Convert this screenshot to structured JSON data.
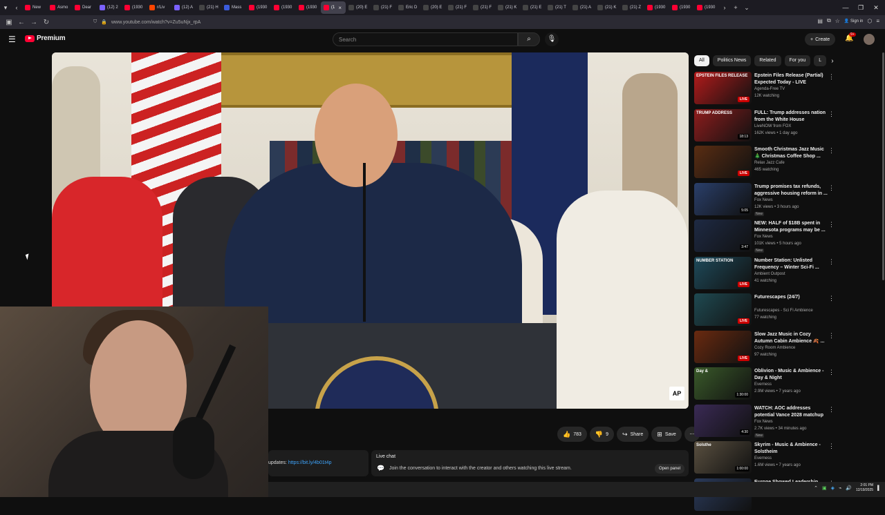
{
  "browser": {
    "tabs": [
      {
        "label": "New",
        "color": "#ff0033"
      },
      {
        "label": "Asmo",
        "color": "#ff0033"
      },
      {
        "label": "Dear",
        "color": "#ff0033"
      },
      {
        "label": "(12) 2",
        "color": "#7b61ff"
      },
      {
        "label": "(1930",
        "color": "#ff0033"
      },
      {
        "label": "r/Liv",
        "color": "#ff4500"
      },
      {
        "label": "(12) A",
        "color": "#7b61ff"
      },
      {
        "label": "(21) H",
        "color": "#444444"
      },
      {
        "label": "Mass",
        "color": "#3b5bdb"
      },
      {
        "label": "(1930",
        "color": "#ff0033"
      },
      {
        "label": "(1930",
        "color": "#ff0033"
      },
      {
        "label": "(1930",
        "color": "#ff0033"
      },
      {
        "label": "(1",
        "color": "#ff0033",
        "active": true
      },
      {
        "label": "(20) E",
        "color": "#444444"
      },
      {
        "label": "(21) F",
        "color": "#444444"
      },
      {
        "label": "Eric D",
        "color": "#444444"
      },
      {
        "label": "(20) E",
        "color": "#444444"
      },
      {
        "label": "(21) F",
        "color": "#444444"
      },
      {
        "label": "(21) F",
        "color": "#444444"
      },
      {
        "label": "(21) K",
        "color": "#444444"
      },
      {
        "label": "(21) E",
        "color": "#444444"
      },
      {
        "label": "(21) T",
        "color": "#444444"
      },
      {
        "label": "(21) A",
        "color": "#444444"
      },
      {
        "label": "(21) K",
        "color": "#444444"
      },
      {
        "label": "(21) Z",
        "color": "#444444"
      },
      {
        "label": "(1930",
        "color": "#ff0033"
      },
      {
        "label": "(1930",
        "color": "#ff0033"
      },
      {
        "label": "(1930",
        "color": "#ff0033"
      }
    ],
    "url": "www.youtube.com/watch?v=Zu5uNjx_rpA",
    "signin_label": "Sign in"
  },
  "header": {
    "logo_text": "Premium",
    "search_placeholder": "Search",
    "create_label": "Create",
    "notif_count": "9+"
  },
  "player": {
    "watermark": "AP"
  },
  "actions": {
    "likes": "783",
    "dislikes": "9",
    "share_label": "Share",
    "save_label": "Save"
  },
  "livebox": {
    "prefix": "updates: ",
    "link": "https://bit.ly/4b01t4p"
  },
  "chat": {
    "title": "Live chat",
    "description": "Join the conversation to interact with the creator and others watching this live stream.",
    "open_label": "Open panel"
  },
  "chips": [
    "All",
    "Politics News",
    "Related",
    "For you",
    "L"
  ],
  "recommendations": [
    {
      "title": "Epstein Files Release (Partial) Expected Today - LIVE Breakin...",
      "channel": "Agenda-Free TV",
      "meta": "12K watching",
      "badge": "LIVE",
      "thumb": "#b31b1b",
      "thumb_text": "EPSTEIN FILES RELEASE"
    },
    {
      "title": "FULL: Trump addresses nation from the White House",
      "channel": "LiveNOW from FOX",
      "meta": "162K views • 1 day ago",
      "duration": "18:13",
      "thumb": "#8e1d1d",
      "thumb_text": "TRUMP ADDRESS"
    },
    {
      "title": "Smooth Christmas Jazz Music 🎄 Christmas Coffee Shop ...",
      "channel": "Relax Jazz Cafe",
      "meta": "465 watching",
      "badge": "LIVE",
      "thumb": "#5a2d12",
      "thumb_text": ""
    },
    {
      "title": "Trump promises tax refunds, aggressive housing reform in ...",
      "channel": "Fox News",
      "meta": "12K views • 3 hours ago",
      "duration": "5:05",
      "new": "New",
      "thumb": "#2a3f6a",
      "thumb_text": ""
    },
    {
      "title": "NEW: HALF of $18B spent in Minnesota programs may be ...",
      "channel": "Fox News",
      "meta": "101K views • 5 hours ago",
      "duration": "3:47",
      "new": "New",
      "thumb": "#1e2a44",
      "thumb_text": ""
    },
    {
      "title": "Number Station: Unlisted Frequency – Winter Sci-Fi ...",
      "channel": "Ambient Outpost",
      "meta": "41 watching",
      "badge": "LIVE",
      "thumb": "#1e4a5a",
      "thumb_text": "NUMBER STATION"
    },
    {
      "title": "Futurescapes (24/7)",
      "channel": "Futurescapes - Sci Fi Ambience",
      "meta": "77 watching",
      "badge": "LIVE",
      "thumb": "#1f4a52",
      "thumb_text": ""
    },
    {
      "title": "Slow Jazz Music in Cozy Autumn Cabin Ambience 🍂 ...",
      "channel": "Cozy Room Ambience",
      "meta": "97 watching",
      "badge": "LIVE",
      "thumb": "#6a2a10",
      "thumb_text": ""
    },
    {
      "title": "Oblivion - Music & Ambience - Day & Night",
      "channel": "Everness",
      "meta": "2.9M views • 7 years ago",
      "duration": "1:30:00",
      "thumb": "#3a5a2a",
      "thumb_text": "Day &"
    },
    {
      "title": "WATCH: AOC addresses potential Vance 2028 matchup",
      "channel": "Fox News",
      "meta": "2.7K views • 34 minutes ago",
      "duration": "4:30",
      "new": "New",
      "thumb": "#3a2a55",
      "thumb_text": ""
    },
    {
      "title": "Skyrim - Music & Ambience - Solstheim",
      "channel": "Everness",
      "meta": "1.6M views • 7 years ago",
      "duration": "1:00:00",
      "thumb": "#5a5040",
      "thumb_text": "Solsthe"
    },
    {
      "title": "Europe Showed Leadership, Zelensky Tells Poland's Tusk",
      "channel": "",
      "meta": "",
      "thumb": "#2a3a5a",
      "thumb_text": ""
    }
  ],
  "taskbar": {
    "time": "2:01 PM",
    "date": "12/19/2025"
  }
}
